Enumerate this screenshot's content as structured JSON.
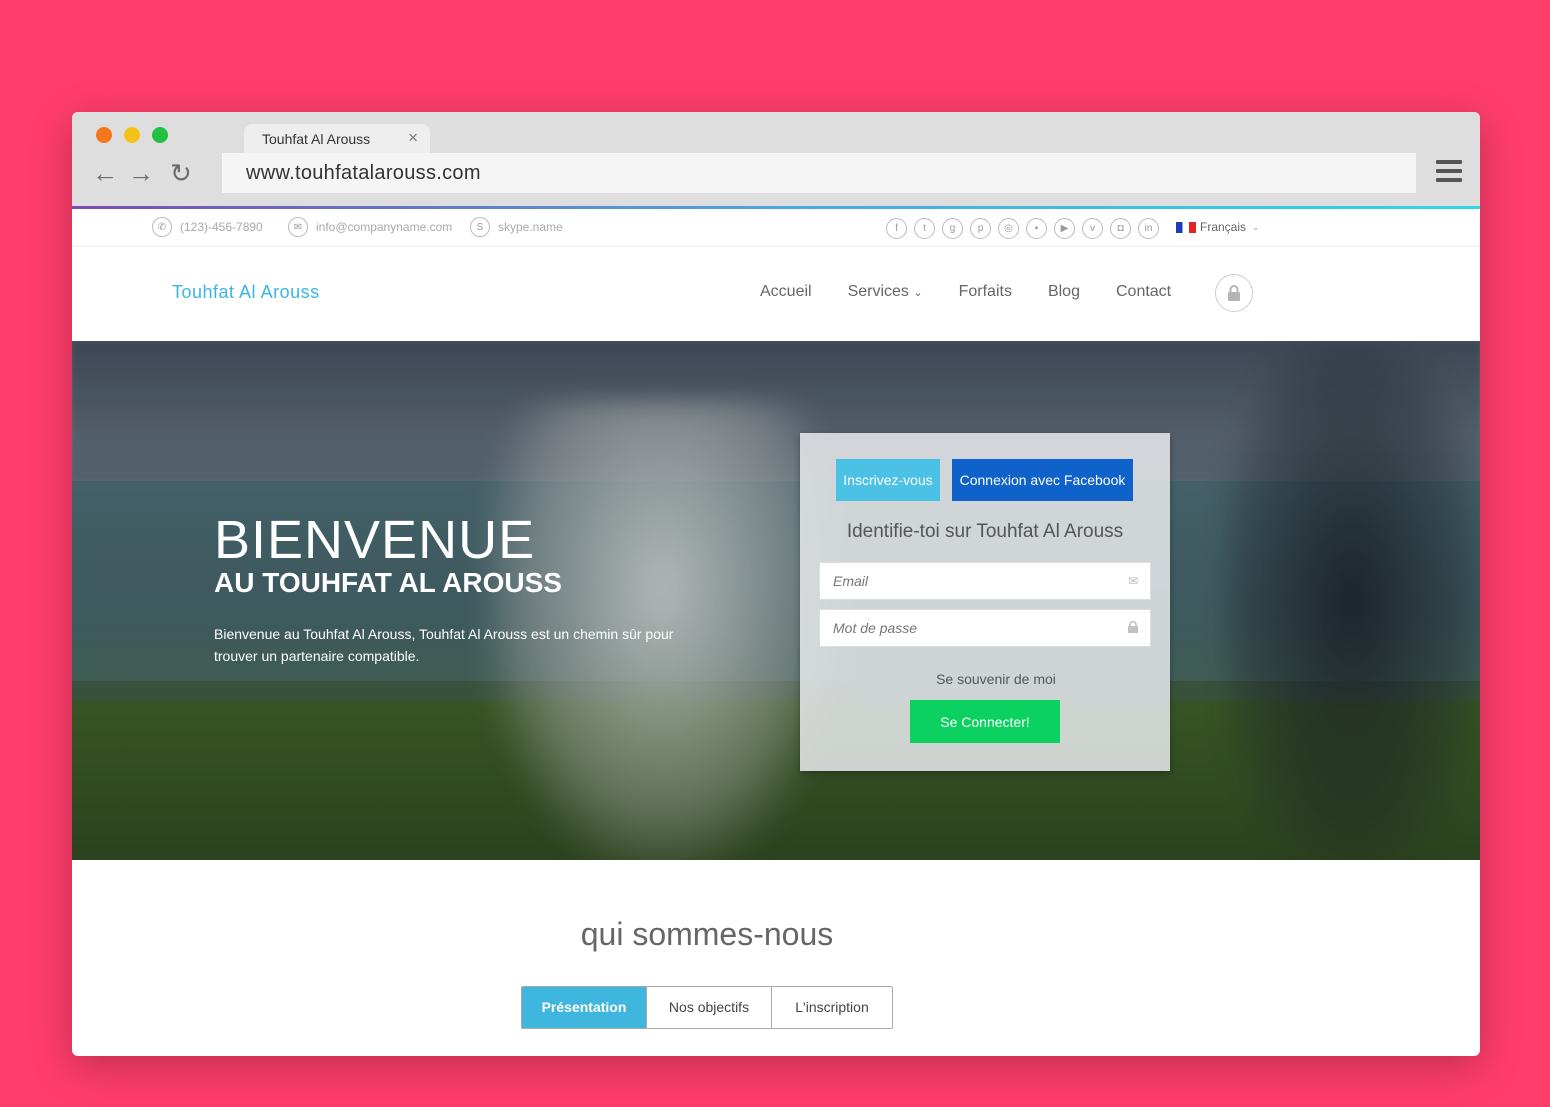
{
  "browser": {
    "tab_title": "Touhfat Al Arouss",
    "url": "www.touhfatalarouss.com"
  },
  "topbar": {
    "phone": "(123)-456-7890",
    "email": "info@companyname.com",
    "skype": "skype.name",
    "language": "Français",
    "socials": [
      "facebook",
      "twitter",
      "google-plus",
      "pinterest",
      "dribbble",
      "flickr",
      "youtube",
      "vimeo",
      "instagram",
      "linkedin"
    ]
  },
  "nav": {
    "brand": "Touhfat Al Arouss",
    "items": [
      "Accueil",
      "Services",
      "Forfaits",
      "Blog",
      "Contact"
    ]
  },
  "hero": {
    "title": "BIENVENUE",
    "subtitle": "AU TOUHFAT AL AROUSS",
    "text": "Bienvenue au Touhfat Al Arouss, Touhfat Al Arouss est un chemin sûr pour trouver un partenaire compatible."
  },
  "login": {
    "register_label": "Inscrivez-vous",
    "facebook_label": "Connexion avec Facebook",
    "title": "Identifie-toi sur Touhfat Al Arouss",
    "email_placeholder": "Email",
    "password_placeholder": "Mot de passe",
    "remember_label": "Se souvenir de moi",
    "submit_label": "Se Connecter!"
  },
  "about": {
    "title": "qui sommes-nous",
    "tabs": [
      "Présentation",
      "Nos objectifs",
      "L'inscription"
    ],
    "active_tab": "Présentation"
  },
  "colors": {
    "page_background": "#ff3d6a",
    "brand": "#39b6e5",
    "facebook": "#0e62c9",
    "connect": "#0bd160"
  }
}
